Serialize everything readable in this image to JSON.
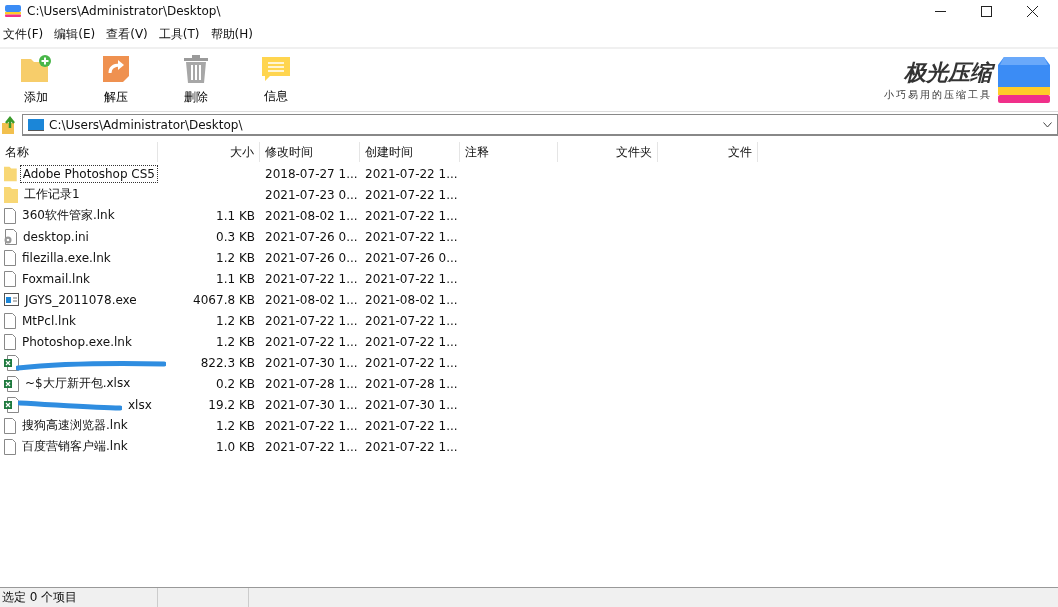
{
  "window": {
    "title": "C:\\Users\\Administrator\\Desktop\\"
  },
  "menu": [
    "文件(F)",
    "编辑(E)",
    "查看(V)",
    "工具(T)",
    "帮助(H)"
  ],
  "toolbar": [
    {
      "kind": "add",
      "label": "添加"
    },
    {
      "kind": "extract",
      "label": "解压"
    },
    {
      "kind": "delete",
      "label": "删除"
    },
    {
      "kind": "info",
      "label": "信息"
    }
  ],
  "brand": {
    "name": "极光压缩",
    "slogan": "小巧易用的压缩工具"
  },
  "address": {
    "value": "C:\\Users\\Administrator\\Desktop\\"
  },
  "table": {
    "columns": [
      {
        "label": "名称"
      },
      {
        "label": "大小"
      },
      {
        "label": "修改时间"
      },
      {
        "label": "创建时间"
      },
      {
        "label": "注释"
      },
      {
        "label": "文件夹"
      },
      {
        "label": "文件"
      }
    ],
    "rows": [
      {
        "kind": "folder",
        "name": "Adobe Photoshop CS5",
        "modified": "2018-07-27 1...",
        "created": "2021-07-22 1...",
        "focused": true,
        "redacted": false
      },
      {
        "kind": "folder",
        "name": "工作记录1",
        "modified": "2021-07-23 0...",
        "created": "2021-07-22 1...",
        "focused": false,
        "redacted": false
      },
      {
        "kind": "file",
        "name": "360软件管家.lnk",
        "size": "1.1 KB",
        "modified": "2021-08-02 1...",
        "created": "2021-07-22 1...",
        "focused": false,
        "redacted": false
      },
      {
        "kind": "settings",
        "name": "desktop.ini",
        "size": "0.3 KB",
        "modified": "2021-07-26 0...",
        "created": "2021-07-22 1...",
        "focused": false,
        "redacted": false
      },
      {
        "kind": "file",
        "name": "filezilla.exe.lnk",
        "size": "1.2 KB",
        "modified": "2021-07-26 0...",
        "created": "2021-07-26 0...",
        "focused": false,
        "redacted": false
      },
      {
        "kind": "file",
        "name": "Foxmail.lnk",
        "size": "1.1 KB",
        "modified": "2021-07-22 1...",
        "created": "2021-07-22 1...",
        "focused": false,
        "redacted": false
      },
      {
        "kind": "exe",
        "name": "JGYS_2011078.exe",
        "size": "4067.8 KB",
        "modified": "2021-08-02 1...",
        "created": "2021-08-02 1...",
        "focused": false,
        "redacted": false
      },
      {
        "kind": "file",
        "name": "MtPcl.lnk",
        "size": "1.2 KB",
        "modified": "2021-07-22 1...",
        "created": "2021-07-22 1...",
        "focused": false,
        "redacted": false
      },
      {
        "kind": "file",
        "name": "Photoshop.exe.lnk",
        "size": "1.2 KB",
        "modified": "2021-07-22 1...",
        "created": "2021-07-22 1...",
        "focused": false,
        "redacted": false
      },
      {
        "kind": "excel",
        "size": "822.3 KB",
        "modified": "2021-07-30 1...",
        "created": "2021-07-22 1...",
        "redacted": true
      },
      {
        "kind": "excel",
        "name": "~$大厅新开包.xlsx",
        "size": "0.2 KB",
        "modified": "2021-07-28 1...",
        "created": "2021-07-28 1...",
        "focused": false,
        "redacted": false
      },
      {
        "kind": "excel",
        "name": "xlsx",
        "size": "19.2 KB",
        "modified": "2021-07-30 1...",
        "created": "2021-07-30 1...",
        "focused": false,
        "redacted": true
      },
      {
        "kind": "file",
        "name": "搜狗高速浏览器.lnk",
        "size": "1.2 KB",
        "modified": "2021-07-22 1...",
        "created": "2021-07-22 1...",
        "focused": false,
        "redacted": false
      },
      {
        "kind": "file",
        "name": "百度营销客户端.lnk",
        "size": "1.0 KB",
        "modified": "2021-07-22 1...",
        "created": "2021-07-22 1...",
        "focused": false,
        "redacted": false
      }
    ]
  },
  "status_bar": {
    "text": "选定 0 个项目"
  }
}
